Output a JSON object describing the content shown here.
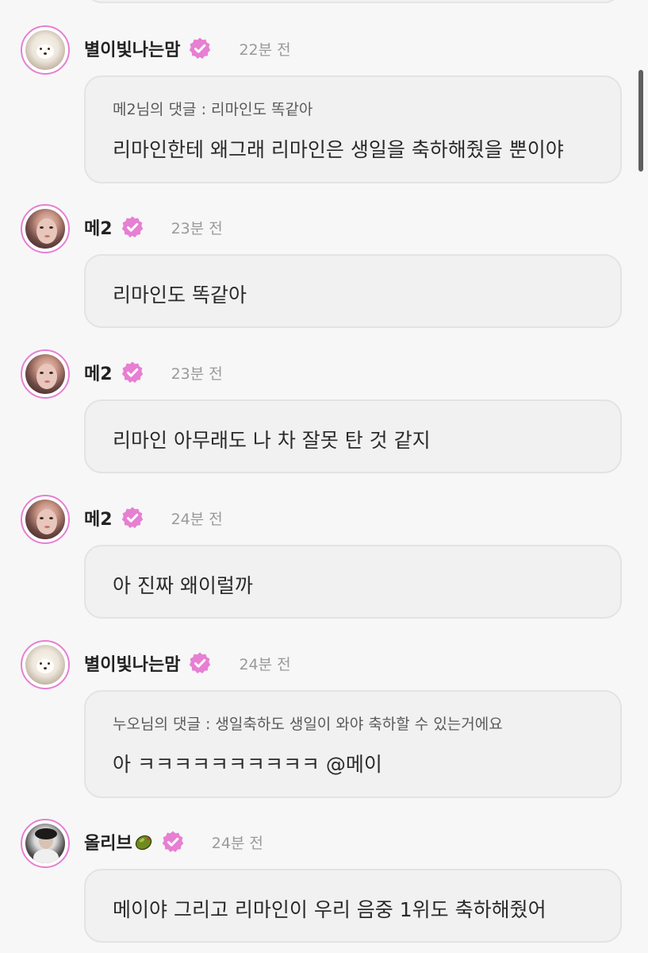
{
  "comments": [
    {
      "username": "별이빛나는맘",
      "time": "22분 전",
      "reply_to": "메2님의 댓글 : 리마인도 똑같아",
      "text": "리마인한테 왜그래 리마인은 생일을 축하해줬을 뿐이야",
      "avatar": "dog-avatar"
    },
    {
      "username": "메2",
      "time": "23분 전",
      "text": "리마인도 똑같아",
      "avatar": "girl-avatar"
    },
    {
      "username": "메2",
      "time": "23분 전",
      "text": "리마인 아무래도 나 차 잘못 탄 것 같지",
      "avatar": "girl-avatar"
    },
    {
      "username": "메2",
      "time": "24분 전",
      "text": "아 진짜 왜이럴까",
      "avatar": "girl-avatar"
    },
    {
      "username": "별이빛나는맘",
      "time": "24분 전",
      "reply_to": "누오님의 댓글 : 생일축하도 생일이 와야 축하할 수 있는거에요",
      "text": "아 ㅋㅋㅋㅋㅋㅋㅋㅋㅋㅋ @메이",
      "avatar": "dog-avatar"
    },
    {
      "username": "올리브",
      "username_emoji": "olive-emoji",
      "time": "24분 전",
      "text": "메이야 그리고 리마인이 우리 음중 1위도 축하해줬어",
      "avatar": "olive-avatar"
    }
  ],
  "colors": {
    "accent": "#e77fd3",
    "bubble_bg": "#f1f1f1",
    "bubble_border": "#e3e3e3",
    "time_text": "#9a9a9a"
  },
  "icons": {
    "verified": "verified-badge-icon"
  }
}
